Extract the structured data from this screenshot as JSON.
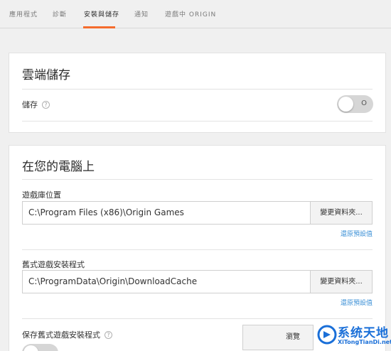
{
  "tabs": [
    {
      "label": "應用程式"
    },
    {
      "label": "診斷"
    },
    {
      "label": "安裝與儲存"
    },
    {
      "label": "通知"
    },
    {
      "label": "遊戲中 ORIGIN"
    }
  ],
  "cloud": {
    "title": "雲端儲存",
    "storage_label": "儲存",
    "toggle_state": "O"
  },
  "pc": {
    "title": "在您的電腦上",
    "library_label": "遊戲庫位置",
    "library_path": "C:\\Program Files (x86)\\Origin Games",
    "library_browse": "變更資料夾...",
    "library_reset": "還原預設值",
    "legacy_label": "舊式遊戲安裝程式",
    "legacy_path": "C:\\ProgramData\\Origin\\DownloadCache",
    "legacy_browse": "變更資料夾...",
    "legacy_reset": "還原預設值",
    "keep_label": "保存舊式遊戲安裝程式",
    "keep_browse": "瀏覽"
  },
  "watermark": {
    "text": "系统天地",
    "url": "XiTongTianDi.net"
  },
  "colors": {
    "accent": "#f56c2d",
    "link": "#3a8fd6",
    "watermark": "#1a6fd8"
  }
}
